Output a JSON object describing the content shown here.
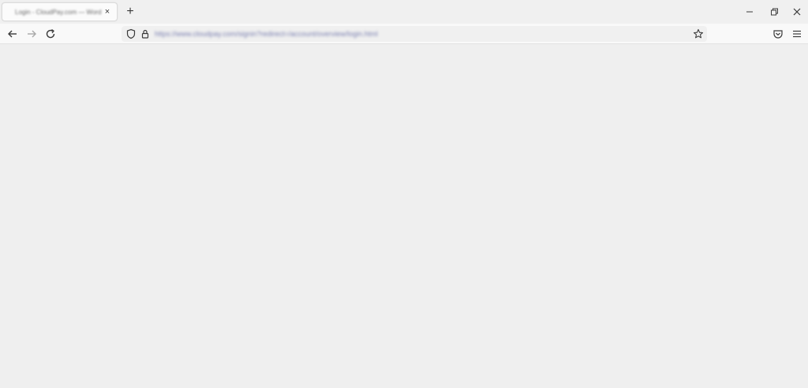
{
  "tabs": [
    {
      "title": "Login - CloudPay.com — Word",
      "close_glyph": "×"
    }
  ],
  "tabstrip": {
    "new_tab_glyph": "+"
  },
  "window_controls": {
    "minimize": "—",
    "restore": "⧉",
    "close": "✕"
  },
  "navbar": {
    "url": "https://www.cloudpay.com/signin?redirect=/account/overview/login.html",
    "icons": [
      "back-icon",
      "forward-icon",
      "reload-icon",
      "shield-icon",
      "lock-icon",
      "bookmark-star-icon",
      "pocket-icon",
      "menu-icon"
    ]
  },
  "colors": {
    "tabstrip_bg": "#f0f0f0",
    "navbar_bg": "#f9f9f9",
    "content_bg": "#efefef",
    "url_text": "#7a7fb0",
    "icon": "#3a3a3a"
  }
}
